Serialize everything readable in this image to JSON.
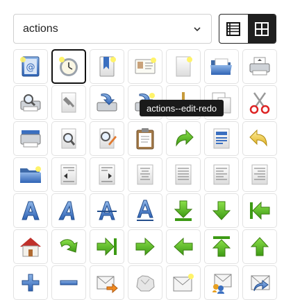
{
  "select": {
    "value": "actions"
  },
  "view_toggle": {
    "list_icon": "list-view-icon",
    "grid_icon": "grid-view-icon",
    "active": "grid"
  },
  "tooltip": {
    "text": "actions--edit-redo"
  },
  "colors": {
    "accent": "#1f1f1f",
    "selected_border": "#111111",
    "tile_border": "#e2e2e2",
    "tooltip_bg": "#1a1a1a"
  },
  "icons": [
    "address-book-icon",
    "appointment-clock-icon",
    "bookmark-new-icon",
    "contact-card-icon",
    "document-new-icon",
    "folder-open-icon",
    "printer-icon",
    "print-preview-icon",
    "document-properties-icon",
    "document-save-icon",
    "document-save-as-icon",
    "edit-clear-icon",
    "edit-copy-icon",
    "edit-cut-icon",
    "printer-delete-icon",
    "document-find-icon",
    "document-edit-icon",
    "edit-paste-icon",
    "edit-redo-icon",
    "format-justify-icon",
    "edit-undo-icon",
    "folder-new-icon",
    "format-indent-less-icon",
    "format-indent-more-icon",
    "format-justify-center-icon",
    "format-justify-fill-icon",
    "format-justify-left-icon",
    "format-justify-right-icon",
    "format-text-bold-icon",
    "format-text-italic-icon",
    "format-text-strikethrough-icon",
    "format-text-underline-icon",
    "go-bottom-icon",
    "go-down-icon",
    "go-first-icon",
    "go-home-icon",
    "go-jump-icon",
    "go-last-icon",
    "go-next-icon",
    "go-previous-icon",
    "go-top-icon",
    "go-up-icon",
    "list-add-icon",
    "list-remove-icon",
    "mail-forward-icon",
    "mail-junk-icon",
    "mail-message-new-icon",
    "mail-reply-all-icon",
    "mail-reply-sender-icon"
  ],
  "selected_index": 1
}
